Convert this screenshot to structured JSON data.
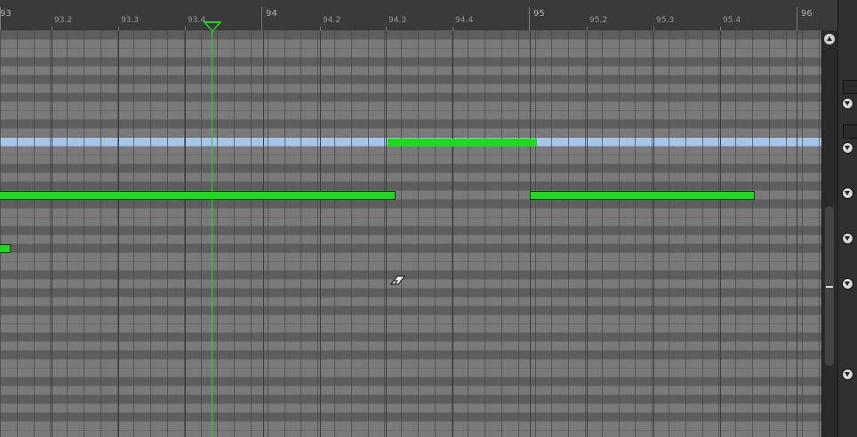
{
  "ruler": {
    "ticks": [
      {
        "label": "93",
        "bar": true
      },
      {
        "label": "93.2",
        "bar": false
      },
      {
        "label": "93.3",
        "bar": false
      },
      {
        "label": "93.4",
        "bar": false
      },
      {
        "label": "94",
        "bar": true
      },
      {
        "label": "94.2",
        "bar": false
      },
      {
        "label": "94.3",
        "bar": false
      },
      {
        "label": "94.4",
        "bar": false
      },
      {
        "label": "95",
        "bar": true
      },
      {
        "label": "95.2",
        "bar": false
      },
      {
        "label": "95.3",
        "bar": false
      },
      {
        "label": "95.4",
        "bar": false
      },
      {
        "label": "96",
        "bar": true
      }
    ]
  },
  "playhead": {
    "position": "93.4"
  },
  "notes": [
    {
      "start": "93 (before view)",
      "end": "94.3",
      "row": "mid"
    },
    {
      "start": "94.3",
      "end": "94.4+",
      "row": "selected"
    },
    {
      "start": "95",
      "end": "95.4",
      "row": "mid"
    },
    {
      "start": "93 (before view)",
      "end": "93",
      "row": "low"
    }
  ],
  "colors": {
    "note": "#1fd81f",
    "selected_row": "#a6c4e8",
    "playhead": "#1fd81f",
    "grid_light": "#7a7a7a",
    "grid_dark": "#5e5e5e"
  },
  "tool": {
    "icon": "eraser-icon"
  }
}
